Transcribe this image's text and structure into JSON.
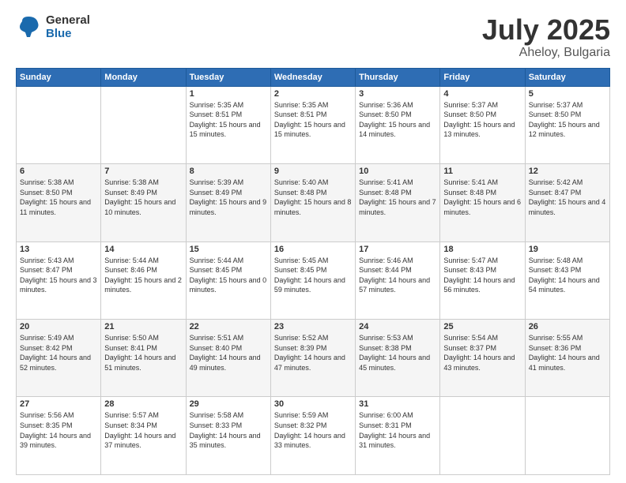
{
  "logo": {
    "general": "General",
    "blue": "Blue"
  },
  "title": {
    "month": "July 2025",
    "location": "Aheloy, Bulgaria"
  },
  "weekdays": [
    "Sunday",
    "Monday",
    "Tuesday",
    "Wednesday",
    "Thursday",
    "Friday",
    "Saturday"
  ],
  "weeks": [
    [
      {
        "day": null
      },
      {
        "day": null
      },
      {
        "day": "1",
        "sunrise": "Sunrise: 5:35 AM",
        "sunset": "Sunset: 8:51 PM",
        "daylight": "Daylight: 15 hours and 15 minutes."
      },
      {
        "day": "2",
        "sunrise": "Sunrise: 5:35 AM",
        "sunset": "Sunset: 8:51 PM",
        "daylight": "Daylight: 15 hours and 15 minutes."
      },
      {
        "day": "3",
        "sunrise": "Sunrise: 5:36 AM",
        "sunset": "Sunset: 8:50 PM",
        "daylight": "Daylight: 15 hours and 14 minutes."
      },
      {
        "day": "4",
        "sunrise": "Sunrise: 5:37 AM",
        "sunset": "Sunset: 8:50 PM",
        "daylight": "Daylight: 15 hours and 13 minutes."
      },
      {
        "day": "5",
        "sunrise": "Sunrise: 5:37 AM",
        "sunset": "Sunset: 8:50 PM",
        "daylight": "Daylight: 15 hours and 12 minutes."
      }
    ],
    [
      {
        "day": "6",
        "sunrise": "Sunrise: 5:38 AM",
        "sunset": "Sunset: 8:50 PM",
        "daylight": "Daylight: 15 hours and 11 minutes."
      },
      {
        "day": "7",
        "sunrise": "Sunrise: 5:38 AM",
        "sunset": "Sunset: 8:49 PM",
        "daylight": "Daylight: 15 hours and 10 minutes."
      },
      {
        "day": "8",
        "sunrise": "Sunrise: 5:39 AM",
        "sunset": "Sunset: 8:49 PM",
        "daylight": "Daylight: 15 hours and 9 minutes."
      },
      {
        "day": "9",
        "sunrise": "Sunrise: 5:40 AM",
        "sunset": "Sunset: 8:48 PM",
        "daylight": "Daylight: 15 hours and 8 minutes."
      },
      {
        "day": "10",
        "sunrise": "Sunrise: 5:41 AM",
        "sunset": "Sunset: 8:48 PM",
        "daylight": "Daylight: 15 hours and 7 minutes."
      },
      {
        "day": "11",
        "sunrise": "Sunrise: 5:41 AM",
        "sunset": "Sunset: 8:48 PM",
        "daylight": "Daylight: 15 hours and 6 minutes."
      },
      {
        "day": "12",
        "sunrise": "Sunrise: 5:42 AM",
        "sunset": "Sunset: 8:47 PM",
        "daylight": "Daylight: 15 hours and 4 minutes."
      }
    ],
    [
      {
        "day": "13",
        "sunrise": "Sunrise: 5:43 AM",
        "sunset": "Sunset: 8:47 PM",
        "daylight": "Daylight: 15 hours and 3 minutes."
      },
      {
        "day": "14",
        "sunrise": "Sunrise: 5:44 AM",
        "sunset": "Sunset: 8:46 PM",
        "daylight": "Daylight: 15 hours and 2 minutes."
      },
      {
        "day": "15",
        "sunrise": "Sunrise: 5:44 AM",
        "sunset": "Sunset: 8:45 PM",
        "daylight": "Daylight: 15 hours and 0 minutes."
      },
      {
        "day": "16",
        "sunrise": "Sunrise: 5:45 AM",
        "sunset": "Sunset: 8:45 PM",
        "daylight": "Daylight: 14 hours and 59 minutes."
      },
      {
        "day": "17",
        "sunrise": "Sunrise: 5:46 AM",
        "sunset": "Sunset: 8:44 PM",
        "daylight": "Daylight: 14 hours and 57 minutes."
      },
      {
        "day": "18",
        "sunrise": "Sunrise: 5:47 AM",
        "sunset": "Sunset: 8:43 PM",
        "daylight": "Daylight: 14 hours and 56 minutes."
      },
      {
        "day": "19",
        "sunrise": "Sunrise: 5:48 AM",
        "sunset": "Sunset: 8:43 PM",
        "daylight": "Daylight: 14 hours and 54 minutes."
      }
    ],
    [
      {
        "day": "20",
        "sunrise": "Sunrise: 5:49 AM",
        "sunset": "Sunset: 8:42 PM",
        "daylight": "Daylight: 14 hours and 52 minutes."
      },
      {
        "day": "21",
        "sunrise": "Sunrise: 5:50 AM",
        "sunset": "Sunset: 8:41 PM",
        "daylight": "Daylight: 14 hours and 51 minutes."
      },
      {
        "day": "22",
        "sunrise": "Sunrise: 5:51 AM",
        "sunset": "Sunset: 8:40 PM",
        "daylight": "Daylight: 14 hours and 49 minutes."
      },
      {
        "day": "23",
        "sunrise": "Sunrise: 5:52 AM",
        "sunset": "Sunset: 8:39 PM",
        "daylight": "Daylight: 14 hours and 47 minutes."
      },
      {
        "day": "24",
        "sunrise": "Sunrise: 5:53 AM",
        "sunset": "Sunset: 8:38 PM",
        "daylight": "Daylight: 14 hours and 45 minutes."
      },
      {
        "day": "25",
        "sunrise": "Sunrise: 5:54 AM",
        "sunset": "Sunset: 8:37 PM",
        "daylight": "Daylight: 14 hours and 43 minutes."
      },
      {
        "day": "26",
        "sunrise": "Sunrise: 5:55 AM",
        "sunset": "Sunset: 8:36 PM",
        "daylight": "Daylight: 14 hours and 41 minutes."
      }
    ],
    [
      {
        "day": "27",
        "sunrise": "Sunrise: 5:56 AM",
        "sunset": "Sunset: 8:35 PM",
        "daylight": "Daylight: 14 hours and 39 minutes."
      },
      {
        "day": "28",
        "sunrise": "Sunrise: 5:57 AM",
        "sunset": "Sunset: 8:34 PM",
        "daylight": "Daylight: 14 hours and 37 minutes."
      },
      {
        "day": "29",
        "sunrise": "Sunrise: 5:58 AM",
        "sunset": "Sunset: 8:33 PM",
        "daylight": "Daylight: 14 hours and 35 minutes."
      },
      {
        "day": "30",
        "sunrise": "Sunrise: 5:59 AM",
        "sunset": "Sunset: 8:32 PM",
        "daylight": "Daylight: 14 hours and 33 minutes."
      },
      {
        "day": "31",
        "sunrise": "Sunrise: 6:00 AM",
        "sunset": "Sunset: 8:31 PM",
        "daylight": "Daylight: 14 hours and 31 minutes."
      },
      {
        "day": null
      },
      {
        "day": null
      }
    ]
  ]
}
